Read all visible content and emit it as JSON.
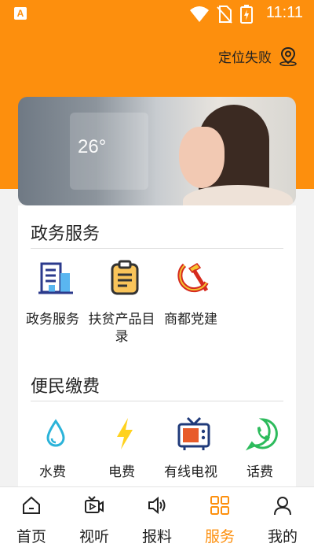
{
  "status_bar": {
    "time": "11:11",
    "app_badge": "A"
  },
  "header": {
    "location_label": "定位失败",
    "location_icon": "map-pin-icon"
  },
  "sections": [
    {
      "title": "政务服务",
      "items": [
        {
          "label": "政务服务",
          "icon": "building-icon"
        },
        {
          "label": "扶贫产品目录",
          "icon": "clipboard-icon"
        },
        {
          "label": "商都党建",
          "icon": "hammer-sickle-icon"
        }
      ]
    },
    {
      "title": "便民缴费",
      "items": [
        {
          "label": "水费",
          "icon": "water-drop-icon"
        },
        {
          "label": "电费",
          "icon": "lightning-icon"
        },
        {
          "label": "有线电视",
          "icon": "tv-icon"
        },
        {
          "label": "话费",
          "icon": "phone-icon"
        }
      ]
    }
  ],
  "nav": [
    {
      "label": "首页",
      "icon": "home-icon"
    },
    {
      "label": "视听",
      "icon": "video-icon"
    },
    {
      "label": "报料",
      "icon": "speaker-icon"
    },
    {
      "label": "服务",
      "icon": "grid-icon",
      "active": true
    },
    {
      "label": "我的",
      "icon": "user-icon"
    }
  ],
  "colors": {
    "accent": "#fd8f0d",
    "text": "#222222"
  }
}
